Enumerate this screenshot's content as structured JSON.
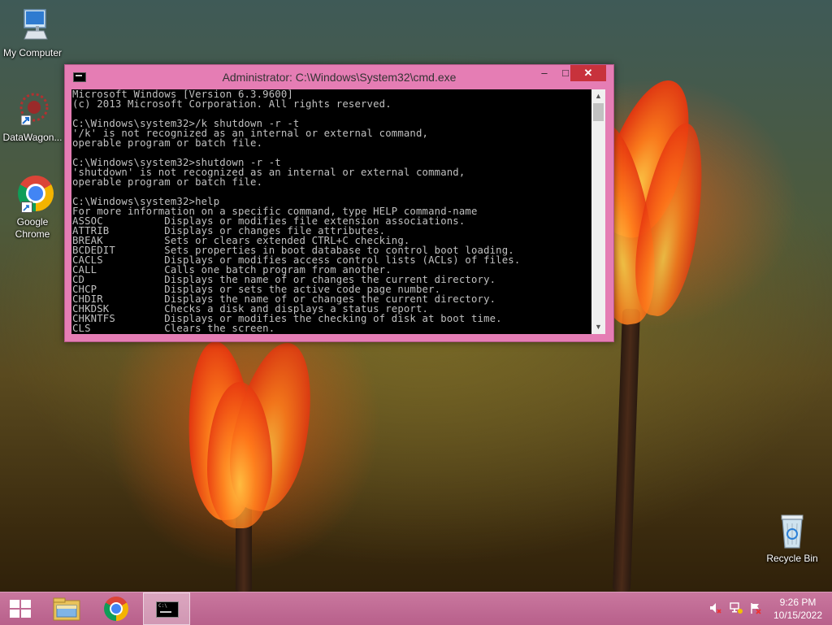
{
  "desktop": {
    "icons": [
      {
        "label": "My Computer",
        "icon": "computer-icon"
      },
      {
        "label": "DataWagon...",
        "icon": "datawagon-icon"
      },
      {
        "label": "Google Chrome",
        "icon": "chrome-icon"
      },
      {
        "label": "Recycle Bin",
        "icon": "recycle-bin-icon"
      }
    ]
  },
  "cmd_window": {
    "title": "Administrator: C:\\Windows\\System32\\cmd.exe",
    "controls": {
      "minimize": "–",
      "maximize": "□",
      "close": "✕"
    },
    "lines": [
      "Microsoft Windows [Version 6.3.9600]",
      "(c) 2013 Microsoft Corporation. All rights reserved.",
      "",
      "C:\\Windows\\system32>/k shutdown -r -t",
      "'/k' is not recognized as an internal or external command,",
      "operable program or batch file.",
      "",
      "C:\\Windows\\system32>shutdown -r -t",
      "'shutdown' is not recognized as an internal or external command,",
      "operable program or batch file.",
      "",
      "C:\\Windows\\system32>help",
      "For more information on a specific command, type HELP command-name",
      "ASSOC          Displays or modifies file extension associations.",
      "ATTRIB         Displays or changes file attributes.",
      "BREAK          Sets or clears extended CTRL+C checking.",
      "BCDEDIT        Sets properties in boot database to control boot loading.",
      "CACLS          Displays or modifies access control lists (ACLs) of files.",
      "CALL           Calls one batch program from another.",
      "CD             Displays the name of or changes the current directory.",
      "CHCP           Displays or sets the active code page number.",
      "CHDIR          Displays the name of or changes the current directory.",
      "CHKDSK         Checks a disk and displays a status report.",
      "CHKNTFS        Displays or modifies the checking of disk at boot time.",
      "CLS            Clears the screen."
    ]
  },
  "taskbar": {
    "items": [
      "start-button",
      "file-explorer",
      "google-chrome",
      "command-prompt"
    ],
    "clock": {
      "time": "9:26 PM",
      "date": "10/15/2022"
    }
  },
  "colors": {
    "window_frame": "#e57db4",
    "taskbar": "#c06a95",
    "close_button": "#c8323c"
  }
}
